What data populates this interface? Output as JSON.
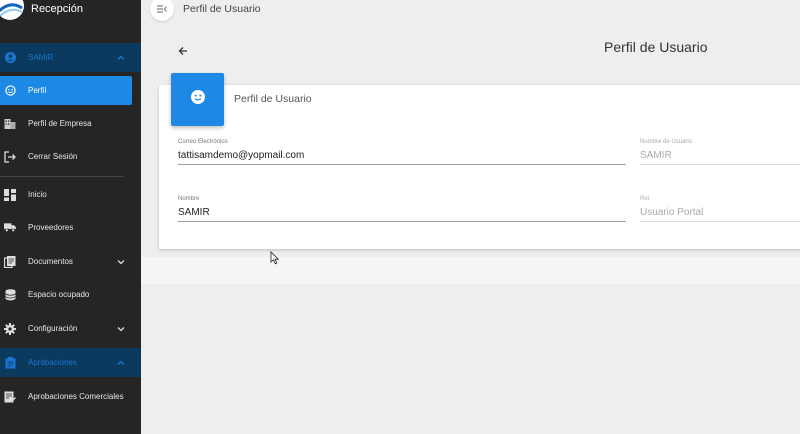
{
  "app": {
    "title": "Recepción"
  },
  "topbar": {
    "title": "Perfil de Usuario"
  },
  "page": {
    "heading": "Perfil de Usuario"
  },
  "sidebar": {
    "user_group": "SAMIR",
    "items": [
      {
        "label": "Perfil",
        "icon": "face-icon"
      },
      {
        "label": "Perfil de Empresa",
        "icon": "building-icon"
      },
      {
        "label": "Cerrar Sesión",
        "icon": "logout-icon"
      },
      {
        "label": "Inicio",
        "icon": "dashboard-icon"
      },
      {
        "label": "Proveedores",
        "icon": "truck-icon"
      },
      {
        "label": "Documentos",
        "icon": "documents-icon"
      },
      {
        "label": "Espacio ocupado",
        "icon": "database-icon"
      },
      {
        "label": "Configuración",
        "icon": "gear-icon"
      }
    ],
    "approvals_group": "Aprobaciones",
    "approvals_items": [
      {
        "label": "Aprobaciones Comerciales",
        "icon": "approval-doc-icon"
      }
    ]
  },
  "card": {
    "title": "Perfil de Usuario",
    "fields": {
      "email": {
        "label": "Correo Electrónico",
        "value": "tattisamdemo@yopmail.com"
      },
      "username": {
        "label": "Nombre de Usuario",
        "value": "SAMIR"
      },
      "name": {
        "label": "Nombre",
        "value": "SAMIR"
      },
      "role": {
        "label": "Rol",
        "value": "Usuario Portal"
      }
    }
  },
  "colors": {
    "accent": "#1e88e5",
    "sidebar_bg": "#252525",
    "group_header_bg": "#0b3a5e"
  }
}
